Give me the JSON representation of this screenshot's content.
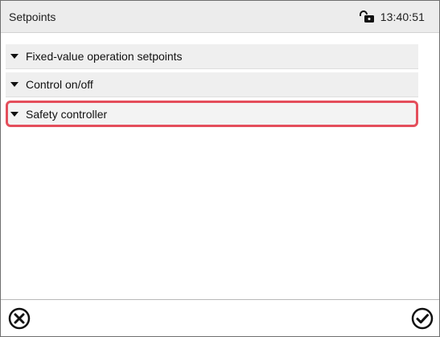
{
  "header": {
    "title": "Setpoints",
    "time": "13:40:51",
    "status_icon": "unlocked-padlock-icon"
  },
  "menu": {
    "items": [
      {
        "label": "Fixed-value operation setpoints",
        "icon": "triangle-down-icon",
        "selected": false
      },
      {
        "label": "Control on/off",
        "icon": "triangle-down-icon",
        "selected": false
      },
      {
        "label": "Safety controller",
        "icon": "triangle-down-icon",
        "selected": true
      }
    ]
  },
  "footer": {
    "cancel_icon": "close-circle-icon",
    "confirm_icon": "check-circle-icon"
  },
  "colors": {
    "header_background": "#ececec",
    "selection_outline": "#e44e5b",
    "menu_background": "#efefef"
  }
}
